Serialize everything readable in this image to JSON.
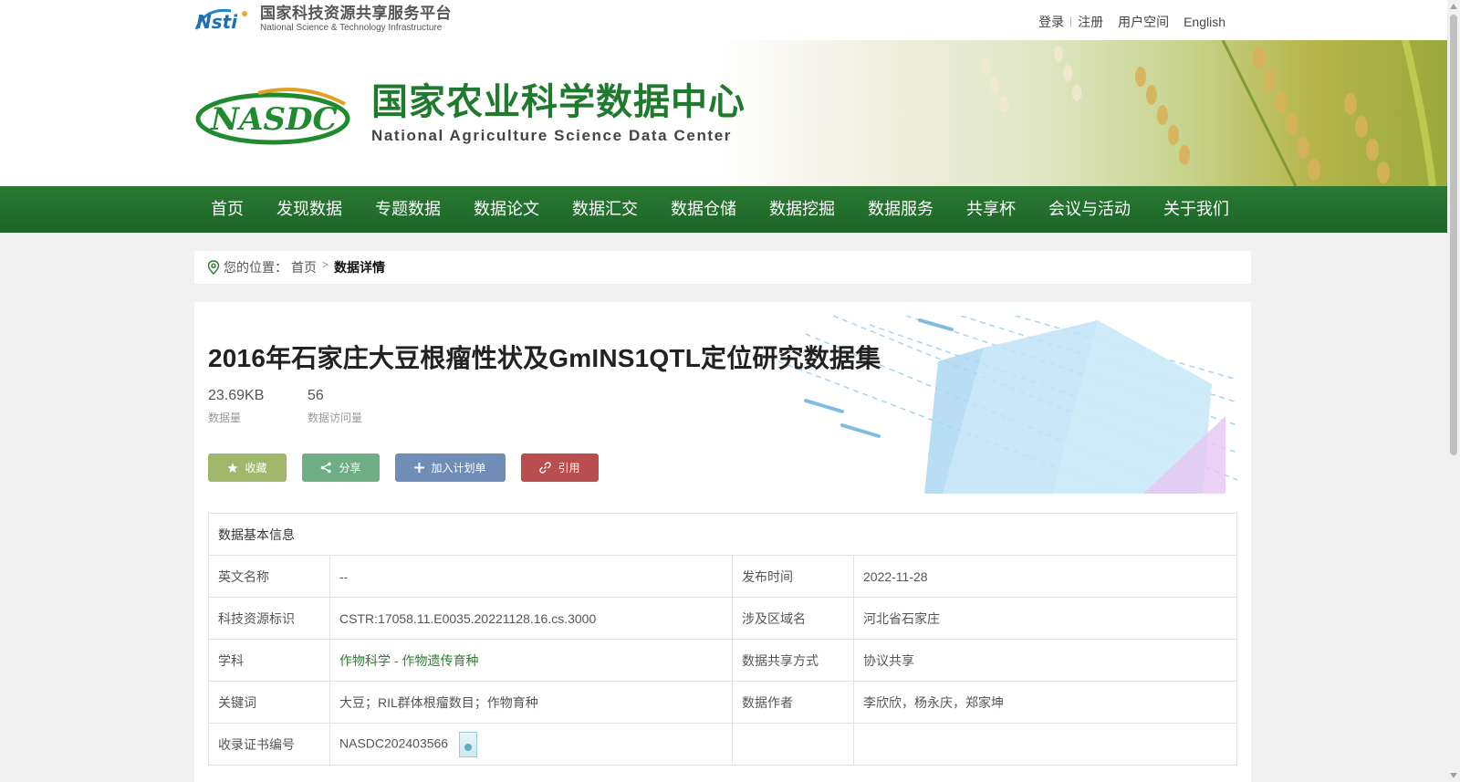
{
  "header": {
    "nsti_cn": "国家科技资源共享服务平台",
    "nsti_en": "National Science & Technology Infrastructure",
    "links": {
      "login": "登录",
      "register": "注册",
      "user_space": "用户空间",
      "english": "English"
    }
  },
  "banner": {
    "title_cn": "国家农业科学数据中心",
    "title_en": "National Agriculture Science Data Center"
  },
  "nav": [
    "首页",
    "发现数据",
    "专题数据",
    "数据论文",
    "数据汇交",
    "数据仓储",
    "数据挖掘",
    "数据服务",
    "共享杯",
    "会议与活动",
    "关于我们"
  ],
  "breadcrumb": {
    "label": "您的位置：",
    "home": "首页",
    "current": "数据详情"
  },
  "dataset": {
    "title": "2016年石家庄大豆根瘤性状及GmINS1QTL定位研究数据集",
    "size_value": "23.69KB",
    "size_label": "数据量",
    "visits_value": "56",
    "visits_label": "数据访问量"
  },
  "buttons": {
    "favorite": "收藏",
    "share": "分享",
    "add_plan": "加入计划单",
    "cite": "引用"
  },
  "info": {
    "heading": "数据基本信息",
    "rows": [
      {
        "k1": "英文名称",
        "v1": "--",
        "k2": "发布时间",
        "v2": "2022-11-28"
      },
      {
        "k1": "科技资源标识",
        "v1": "CSTR:17058.11.E0035.20221128.16.cs.3000",
        "k2": "涉及区域名",
        "v2": "河北省石家庄"
      },
      {
        "k1": "学科",
        "v1": "作物科学 - 作物遗传育种",
        "k2": "数据共享方式",
        "v2": "协议共享"
      },
      {
        "k1": "关键词",
        "v1": "大豆；RIL群体根瘤数目；作物育种",
        "k2": "数据作者",
        "v2": "李欣欣，杨永庆，郑家坤"
      },
      {
        "k1": "收录证书编号",
        "v1": "NASDC202403566",
        "k2": "",
        "v2": ""
      }
    ]
  },
  "colors": {
    "brand_green": "#1f6e2c",
    "fav": "#9fb86b",
    "share": "#6fae84",
    "plan": "#6f8db6",
    "cite": "#b94e4e"
  }
}
